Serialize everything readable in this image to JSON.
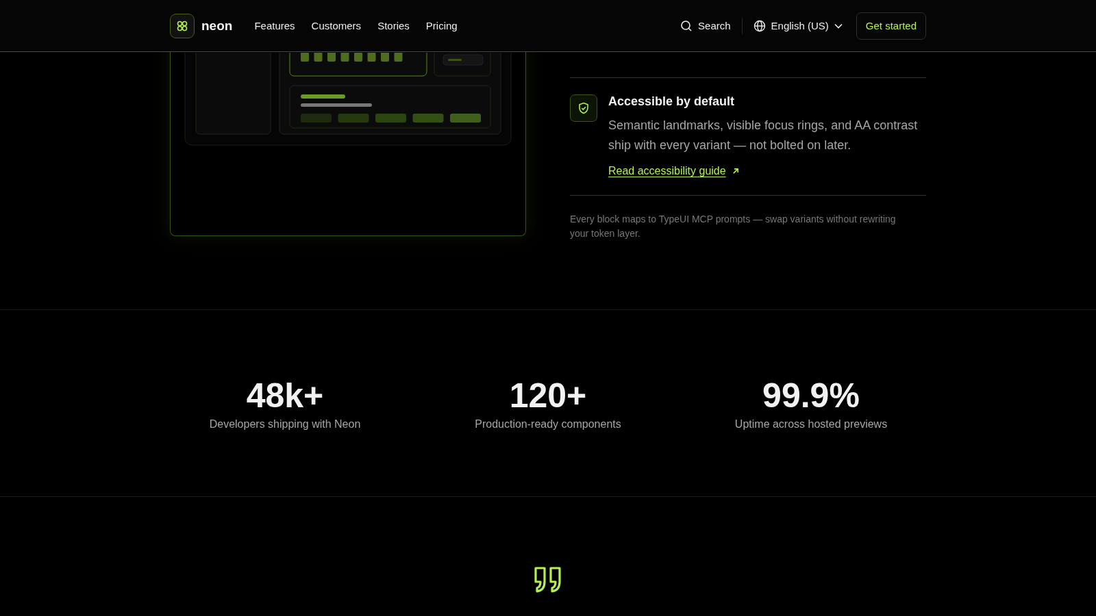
{
  "header": {
    "brand": "neon",
    "nav": [
      {
        "label": "Features"
      },
      {
        "label": "Customers"
      },
      {
        "label": "Stories"
      },
      {
        "label": "Pricing"
      }
    ],
    "search": "Search",
    "language": "English (US)",
    "cta": "Get started"
  },
  "features": [
    {
      "kind": "full",
      "title": "Accessible by default",
      "body": "Semantic landmarks, visible focus rings, and AA contrast ship with every variant — not bolted on later.",
      "link": "Read accessibility guide"
    }
  ],
  "note": "Every block maps to TypeUI MCP prompts — swap variants without rewriting your token layer.",
  "stats": [
    {
      "value": "48k+",
      "label": "Developers shipping with Neon"
    },
    {
      "value": "120+",
      "label": "Production-ready components"
    },
    {
      "value": "99.9%",
      "label": "Uptime across hosted previews"
    }
  ]
}
